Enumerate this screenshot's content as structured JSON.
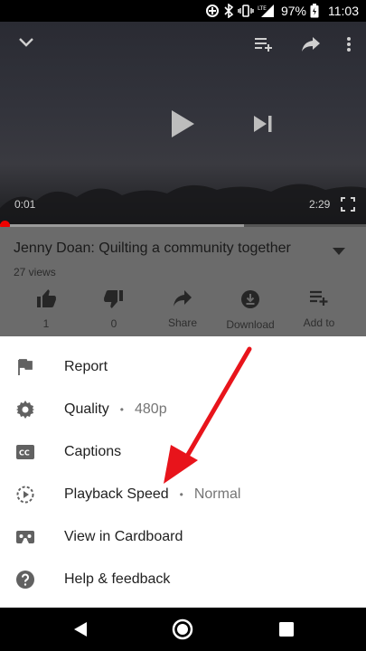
{
  "status_bar": {
    "battery": "97%",
    "time": "11:03",
    "network": "LTE"
  },
  "player": {
    "current_time": "0:01",
    "duration": "2:29",
    "progress_fraction": 0.007,
    "buffer_fraction": 0.667
  },
  "video": {
    "title": "Jenny Doan: Quilting a community together",
    "views": "27 views"
  },
  "actions": [
    {
      "label": "1",
      "icon": "thumb-up-icon"
    },
    {
      "label": "0",
      "icon": "thumb-down-icon"
    },
    {
      "label": "Share",
      "icon": "share-icon"
    },
    {
      "label": "Download",
      "icon": "download-icon"
    },
    {
      "label": "Add to",
      "icon": "playlist-add-icon"
    }
  ],
  "menu": [
    {
      "label": "Report",
      "icon": "flag-icon"
    },
    {
      "label": "Quality",
      "value": "480p",
      "icon": "gear-icon"
    },
    {
      "label": "Captions",
      "icon": "captions-icon"
    },
    {
      "label": "Playback Speed",
      "value": "Normal",
      "icon": "playback-speed-icon"
    },
    {
      "label": "View in Cardboard",
      "icon": "cardboard-icon"
    },
    {
      "label": "Help & feedback",
      "icon": "help-icon"
    }
  ],
  "colors": {
    "annotation_arrow": "#e8141b",
    "progress_played": "#e00000",
    "sheet_background": "#ffffff"
  }
}
